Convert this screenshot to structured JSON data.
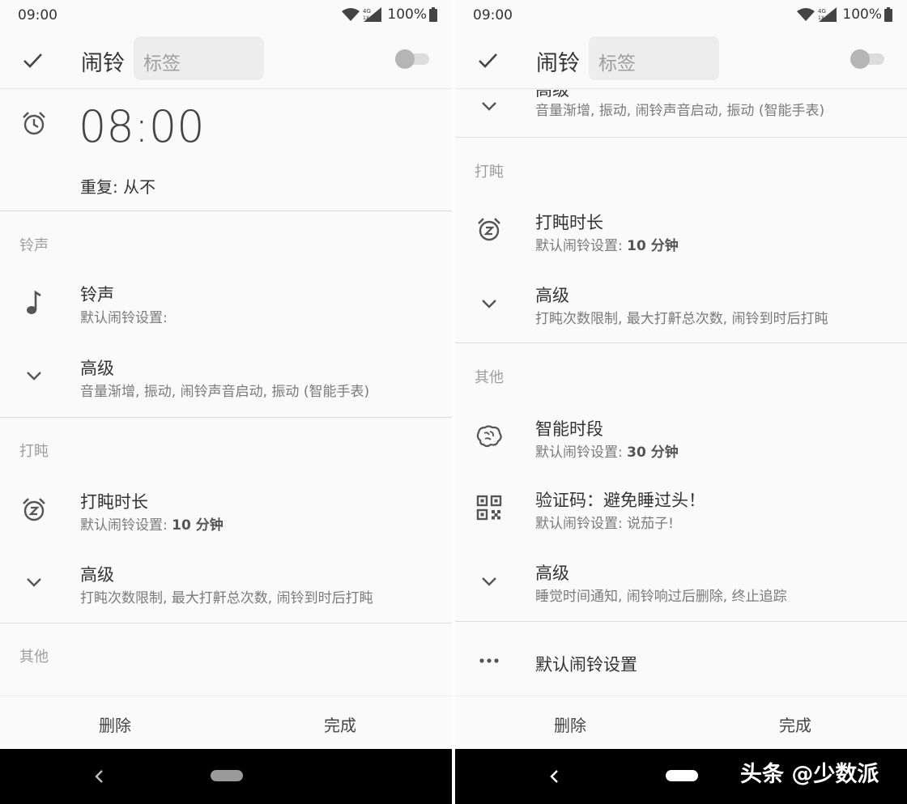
{
  "status": {
    "time": "09:00",
    "network": "4G",
    "network_sub": "1X",
    "battery": "100%"
  },
  "topbar": {
    "title": "闹铃",
    "label_placeholder": "标签"
  },
  "alarm": {
    "time": "08:00",
    "repeat": "重复: 从不"
  },
  "sections": {
    "ringtone": "铃声",
    "snooze": "打盹",
    "other": "其他"
  },
  "ringtone_row": {
    "title": "铃声",
    "subtitle": "默认闹铃设置:"
  },
  "ringtone_advanced": {
    "title": "高级",
    "subtitle": "音量渐增, 振动, 闹铃声音启动, 振动 (智能手表)",
    "partial_title": "高级"
  },
  "snooze_duration": {
    "title": "打盹时长",
    "subtitle_prefix": "默认闹铃设置: ",
    "subtitle_value": "10 分钟"
  },
  "snooze_advanced": {
    "title": "高级",
    "subtitle": "打盹次数限制, 最大打鼾总次数, 闹铃到时后打盹"
  },
  "smart_period": {
    "title": "智能时段",
    "subtitle_prefix": "默认闹铃设置: ",
    "subtitle_value": "30 分钟"
  },
  "captcha": {
    "title": "验证码：避免睡过头！",
    "subtitle": "默认闹铃设置: 说茄子!"
  },
  "other_advanced": {
    "title": "高级",
    "subtitle": "睡觉时间通知, 闹铃响过后删除, 终止追踪"
  },
  "default_settings": {
    "title": "默认闹铃设置"
  },
  "actions": {
    "delete": "删除",
    "done": "完成"
  },
  "watermark": "头条 @少数派",
  "icons": {
    "check": "check-icon",
    "alarm": "alarm-clock-icon",
    "music": "music-note-icon",
    "chevron": "chevron-down-icon",
    "snooze": "snooze-icon",
    "brain": "brain-icon",
    "qr": "qr-code-icon",
    "more": "more-horizontal-icon"
  }
}
